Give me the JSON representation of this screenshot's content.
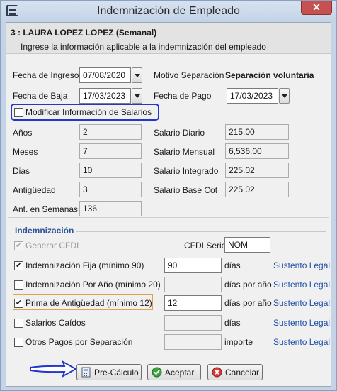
{
  "window": {
    "title": "Indemnización de Empleado",
    "close_glyph": "✕"
  },
  "header": {
    "employee": "3 : LAURA LOPEZ LOPEZ (Semanal)",
    "subtitle": "Ingrese la información aplicable a la indemnización del empleado"
  },
  "dates": {
    "ingreso_label": "Fecha de Ingreso",
    "ingreso_value": "07/08/2020",
    "baja_label": "Fecha de Baja",
    "baja_value": "17/03/2023",
    "motivo_label": "Motivo Separación",
    "motivo_value": "Separación voluntaria",
    "pago_label": "Fecha de Pago",
    "pago_value": "17/03/2023"
  },
  "modificar": {
    "label": "Modificar Información de Salarios",
    "checked": false
  },
  "antiguedad": {
    "anios_label": "Años",
    "anios_value": "2",
    "meses_label": "Meses",
    "meses_value": "7",
    "dias_label": "Dias",
    "dias_value": "10",
    "antig_label": "Antigüedad",
    "antig_value": "3",
    "semanas_label": "Ant. en Semanas",
    "semanas_value": "136"
  },
  "salarios": {
    "diario_label": "Salario Diario",
    "diario_value": "215.00",
    "mensual_label": "Salario Mensual",
    "mensual_value": "6,536.00",
    "integrado_label": "Salario Integrado",
    "integrado_value": "225.02",
    "basecot_label": "Salario Base Cot",
    "basecot_value": "225.02"
  },
  "indemnizacion": {
    "group_title": "Indemnización",
    "generar_cfdi_label": "Generar CFDI",
    "cfdi_serie_label": "CFDI Serie",
    "cfdi_serie_value": "NOM",
    "rows": [
      {
        "label": "Indemnización Fija (mínimo 90)",
        "checked": true,
        "value": "90",
        "unit": "días",
        "link": "Sustento Legal"
      },
      {
        "label": "Indemnización Por Año (mínimo 20)",
        "checked": false,
        "value": "",
        "unit": "días por año",
        "link": "Sustento Legal"
      },
      {
        "label": "Prima de Antigüedad (mínimo 12)",
        "checked": true,
        "value": "12",
        "unit": "días por año",
        "link": "Sustento Legal"
      },
      {
        "label": "Salarios Caídos",
        "checked": false,
        "value": "",
        "unit": "días",
        "link": "Sustento Legal"
      },
      {
        "label": "Otros Pagos por Separación",
        "checked": false,
        "value": "",
        "unit": "importe",
        "link": "Sustento Legal"
      }
    ]
  },
  "buttons": {
    "precalculo": "Pre-Cálculo",
    "aceptar": "Aceptar",
    "cancelar": "Cancelar"
  },
  "icons": {
    "check_glyph": "✔"
  },
  "colors": {
    "link": "#1f4fa8",
    "highlight": "#2436c9",
    "group_title": "#2f5597"
  }
}
